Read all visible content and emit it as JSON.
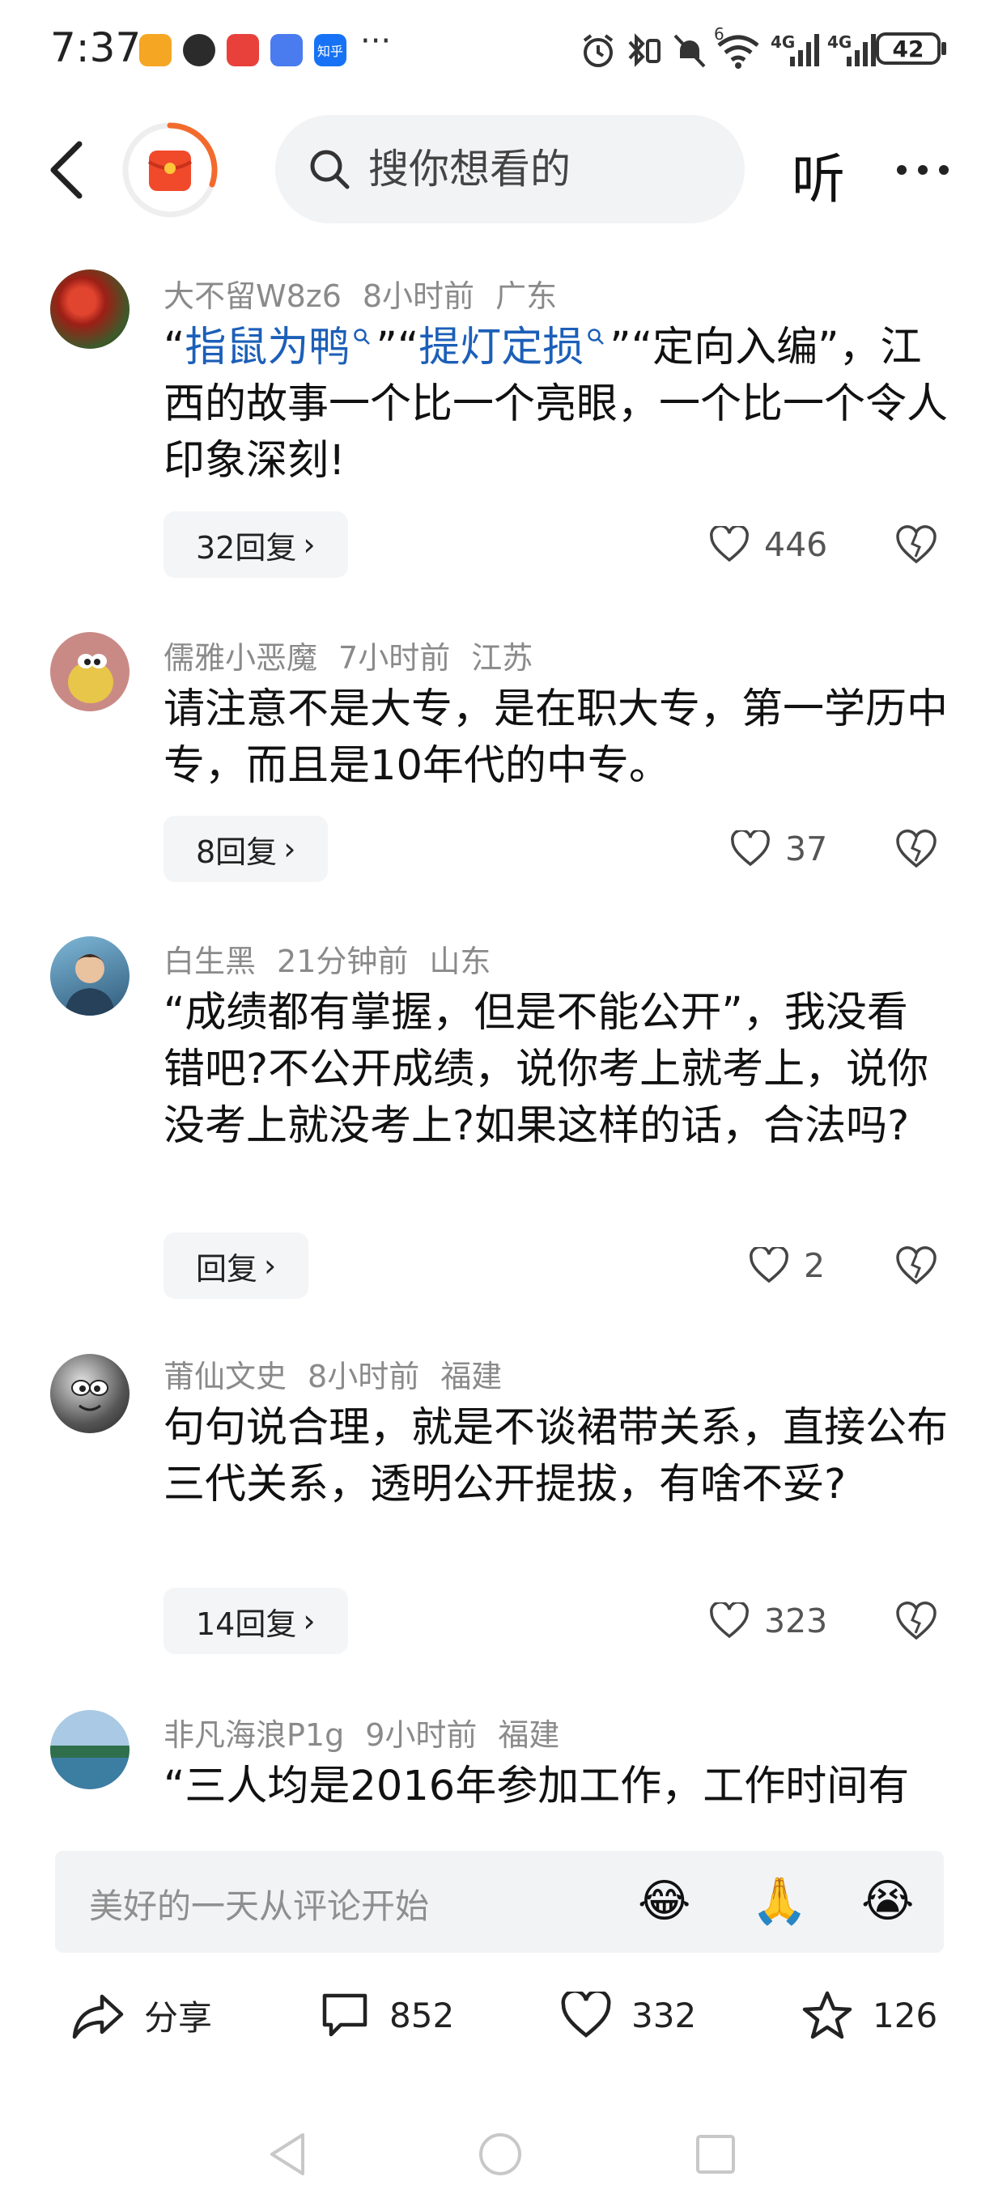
{
  "status_bar": {
    "time": "7:37",
    "more": "···",
    "battery": "42",
    "app_icons": [
      "notes-icon",
      "photo-icon",
      "red-app-icon",
      "blue-app-icon",
      "zhihu-icon"
    ],
    "zhihu_label": "知乎",
    "signal_1": "4G",
    "signal_2": "4G",
    "wifi_label": "6"
  },
  "nav": {
    "search_placeholder": "搜你想看的",
    "listen_label": "听"
  },
  "comments": [
    {
      "user": "大不留W8z6",
      "time": "8小时前",
      "location": "广东",
      "text_parts": [
        "“",
        "指鼠为鸭",
        "”“",
        "提灯定损",
        "”“定向入编”，江西的故事一个比一个亮眼，一个比一个令人印象深刻!"
      ],
      "replies": "32回复",
      "likes": "446"
    },
    {
      "user": "儒雅小恶魔",
      "time": "7小时前",
      "location": "江苏",
      "text": "请注意不是大专，是在职大专，第一学历中专，而且是10年代的中专。",
      "replies": "8回复",
      "likes": "37"
    },
    {
      "user": "白生黑",
      "time": "21分钟前",
      "location": "山东",
      "text": "“成绩都有掌握，但是不能公开”，我没看错吧?不公开成绩，说你考上就考上，说你没考上就没考上?如果这样的话，合法吗?",
      "replies": "回复",
      "likes": "2"
    },
    {
      "user": "莆仙文史",
      "time": "8小时前",
      "location": "福建",
      "text": "句句说合理，就是不谈裙带关系，直接公布三代关系，透明公开提拔，有啥不妥?",
      "replies": "14回复",
      "likes": "323"
    },
    {
      "user": "非凡海浪P1g",
      "time": "9小时前",
      "location": "福建",
      "text": "“三人均是2016年参加工作，工作时间有"
    }
  ],
  "comment_box": {
    "placeholder": "美好的一天从评论开始",
    "emojis": [
      "😂",
      "🙏",
      "😭"
    ]
  },
  "actions": {
    "share": "分享",
    "comments": "852",
    "likes": "332",
    "favorites": "126"
  },
  "colors": {
    "highlight": "#1c5fb8",
    "meta": "#8a8a8a",
    "logo_orange": "#f36b2c"
  }
}
